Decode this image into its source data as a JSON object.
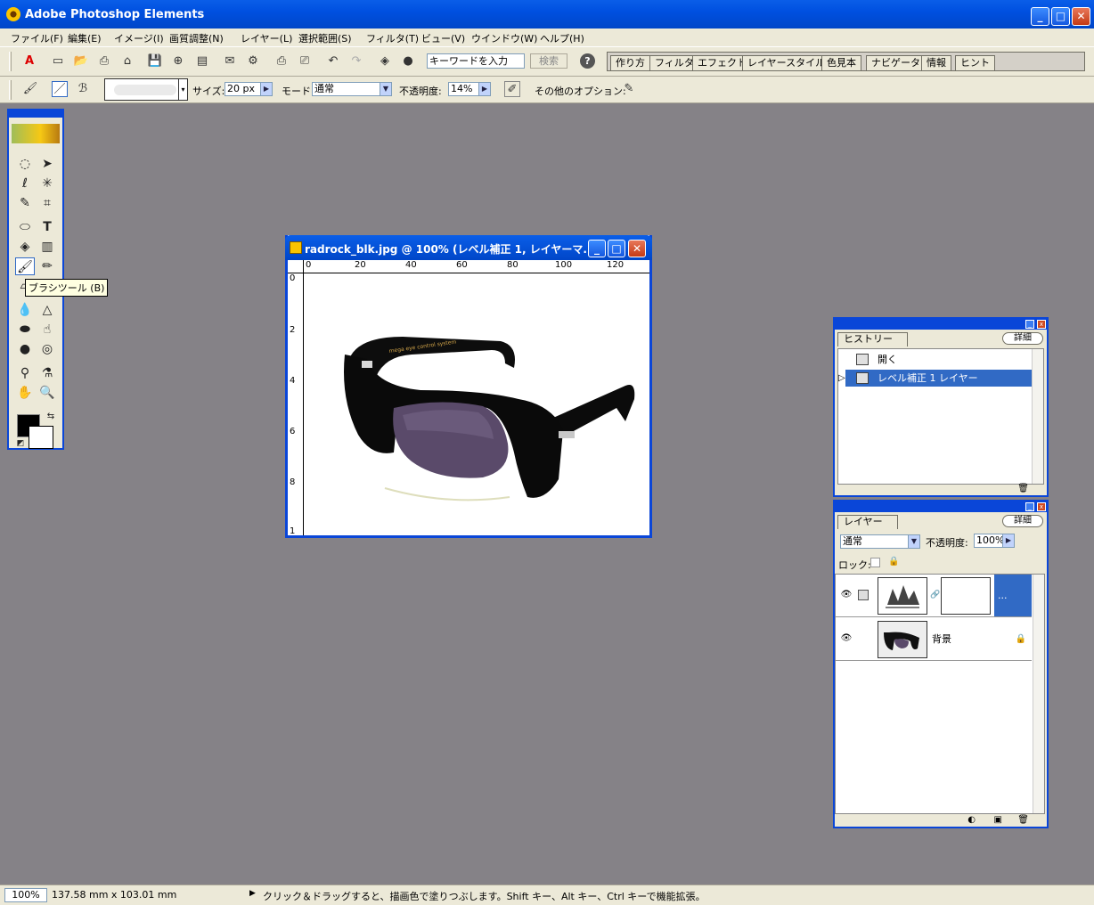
{
  "app": {
    "title": "Adobe Photoshop Elements"
  },
  "menu": [
    "ファイル(F)",
    "編集(E)",
    "イメージ(I)",
    "画質調整(N)",
    "レイヤー(L)",
    "選択範囲(S)",
    "フィルタ(T)",
    "ビュー(V)",
    "ウインドウ(W)",
    "ヘルプ(H)"
  ],
  "search": {
    "placeholder": "キーワードを入力",
    "button": "検索"
  },
  "palette_well": [
    "作り方",
    "フィルタ",
    "エフェクト",
    "レイヤースタイル",
    "色見本",
    "ナビゲータ",
    "情報",
    "ヒント"
  ],
  "options": {
    "size_label": "サイズ:",
    "size_value": "20 px",
    "mode_label": "モード:",
    "mode_value": "通常",
    "opacity_label": "不透明度:",
    "opacity_value": "14%",
    "more_options_label": "その他のオプション:"
  },
  "tooltip": "ブラシツール (B)",
  "document": {
    "title": "radrock_blk.jpg @ 100% (レベル補正 1, レイヤーマ...",
    "ruler_top": [
      "0",
      "20",
      "40",
      "60",
      "80",
      "100",
      "120"
    ],
    "ruler_left": [
      "0",
      "2",
      "4",
      "6",
      "8",
      "1"
    ],
    "temple_text": "mega eye control system"
  },
  "history": {
    "tab": "ヒストリー",
    "more": "詳細",
    "items": [
      {
        "label": "開く"
      },
      {
        "label": "レベル補正 1 レイヤー"
      }
    ]
  },
  "layers": {
    "tab": "レイヤー",
    "more": "詳細",
    "blend_mode": "通常",
    "opacity_label": "不透明度:",
    "opacity_value": "100%",
    "lock_label": "ロック:",
    "items": [
      {
        "label": "..."
      },
      {
        "label": "背景"
      }
    ]
  },
  "status": {
    "zoom": "100%",
    "dimensions": "137.58 mm x 103.01 mm",
    "hint": "クリック＆ドラッグすると、描画色で塗りつぶします。Shift キー、Alt キー、Ctrl キーで機能拡張。"
  },
  "colors": {
    "title_blue": "#0a46d8",
    "workspace": "#858287",
    "selection": "#316ac5"
  }
}
